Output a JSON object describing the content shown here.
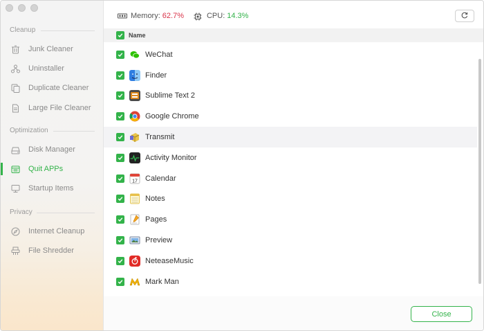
{
  "sidebar": {
    "sections": [
      {
        "label": "Cleanup",
        "items": [
          {
            "label": "Junk Cleaner",
            "icon": "trash-icon"
          },
          {
            "label": "Uninstaller",
            "icon": "uninstaller-icon"
          },
          {
            "label": "Duplicate Cleaner",
            "icon": "duplicate-icon"
          },
          {
            "label": "Large File Cleaner",
            "icon": "large-file-icon"
          }
        ]
      },
      {
        "label": "Optimization",
        "items": [
          {
            "label": "Disk Manager",
            "icon": "disk-icon"
          },
          {
            "label": "Quit APPs",
            "icon": "quit-apps-icon",
            "active": true
          },
          {
            "label": "Startup Items",
            "icon": "monitor-icon"
          }
        ]
      },
      {
        "label": "Privacy",
        "items": [
          {
            "label": "Internet Cleanup",
            "icon": "compass-icon"
          },
          {
            "label": "File Shredder",
            "icon": "shredder-icon"
          }
        ]
      }
    ]
  },
  "stats": {
    "memory_label": "Memory:",
    "memory_value": "62.7%",
    "cpu_label": "CPU:",
    "cpu_value": "14.3%"
  },
  "table": {
    "header": "Name",
    "rows": [
      {
        "name": "WeChat",
        "checked": true
      },
      {
        "name": "Finder",
        "checked": true
      },
      {
        "name": "Sublime Text 2",
        "checked": true
      },
      {
        "name": "Google Chrome",
        "checked": true
      },
      {
        "name": "Transmit",
        "checked": true,
        "highlighted": true
      },
      {
        "name": "Activity Monitor",
        "checked": true
      },
      {
        "name": "Calendar",
        "checked": true
      },
      {
        "name": "Notes",
        "checked": true
      },
      {
        "name": "Pages",
        "checked": true
      },
      {
        "name": "Preview",
        "checked": true
      },
      {
        "name": "NeteaseMusic",
        "checked": true
      },
      {
        "name": "Mark Man",
        "checked": true
      }
    ]
  },
  "footer": {
    "close_label": "Close"
  },
  "colors": {
    "accent": "#33b34a",
    "memory": "#d9344a"
  }
}
